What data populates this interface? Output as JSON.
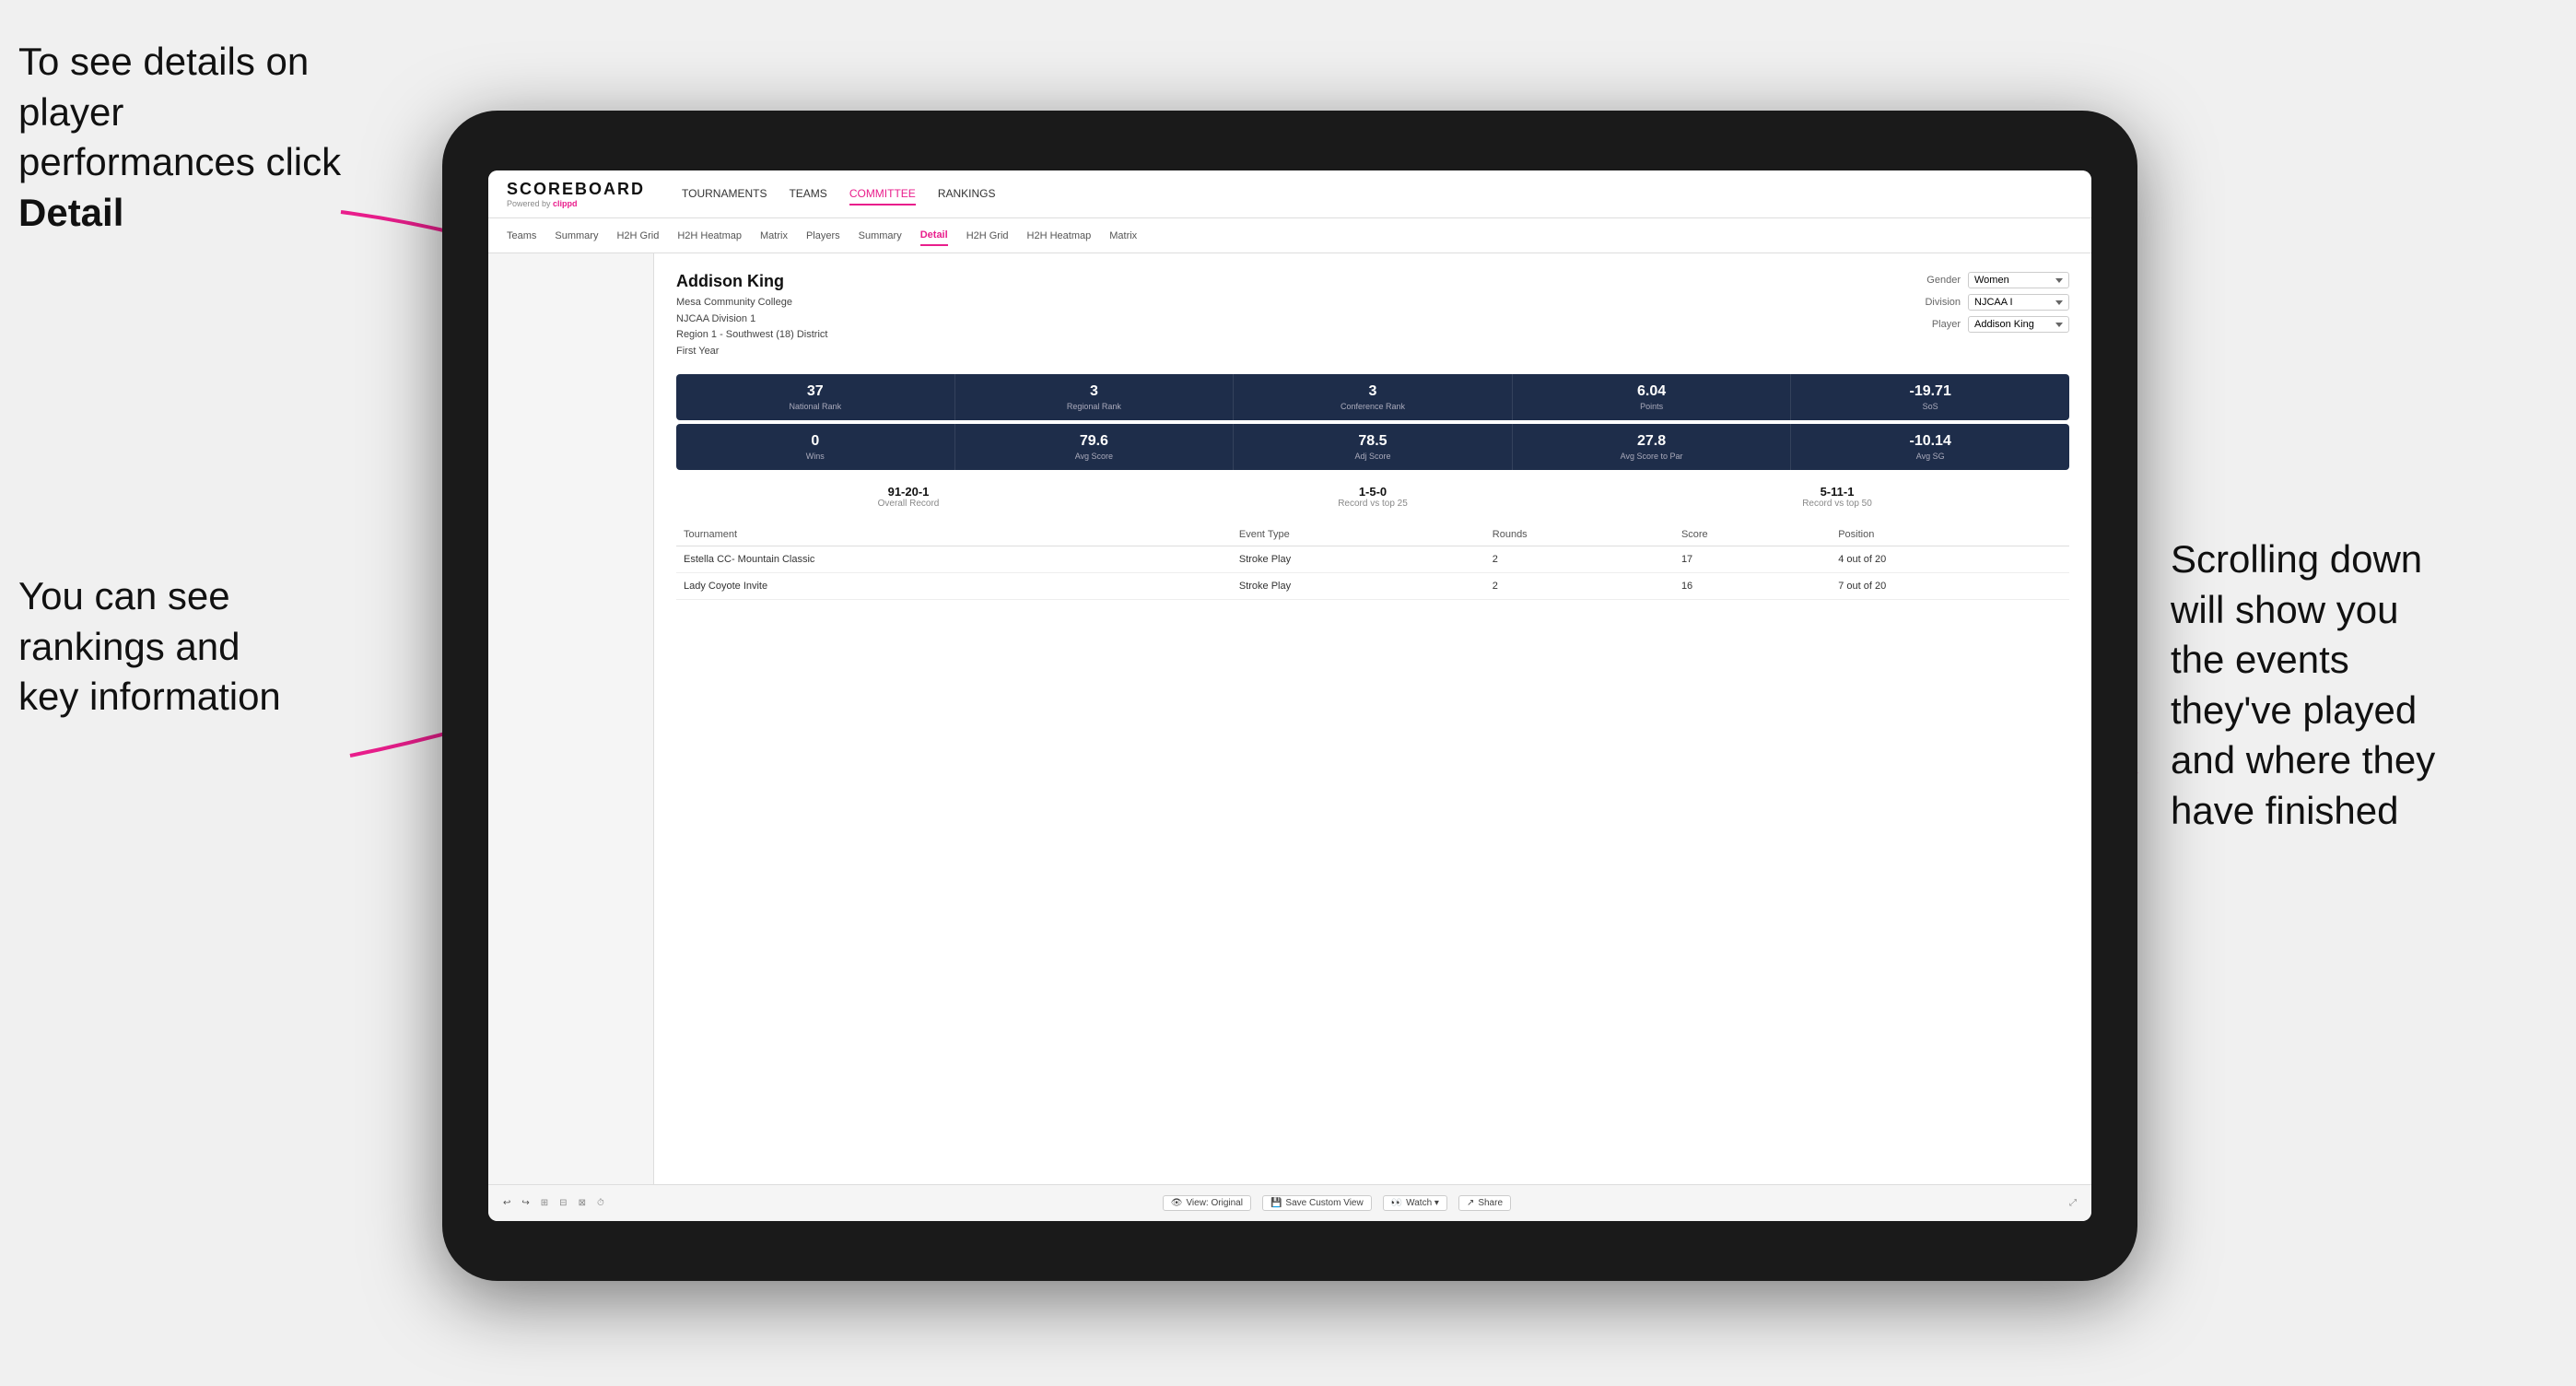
{
  "annotations": {
    "topleft": "To see details on player performances click ",
    "topleft_bold": "Detail",
    "bottomleft_line1": "You can see",
    "bottomleft_line2": "rankings and",
    "bottomleft_line3": "key information",
    "right_line1": "Scrolling down",
    "right_line2": "will show you",
    "right_line3": "the events",
    "right_line4": "they've played",
    "right_line5": "and where they",
    "right_line6": "have finished"
  },
  "nav": {
    "logo": "SCOREBOARD",
    "powered_by": "Powered by ",
    "clippd": "clippd",
    "items": [
      "TOURNAMENTS",
      "TEAMS",
      "COMMITTEE",
      "RANKINGS"
    ]
  },
  "sub_nav": {
    "items": [
      "Teams",
      "Summary",
      "H2H Grid",
      "H2H Heatmap",
      "Matrix",
      "Players",
      "Summary",
      "Detail",
      "H2H Grid",
      "H2H Heatmap",
      "Matrix"
    ],
    "active": "Detail"
  },
  "player": {
    "name": "Addison King",
    "school": "Mesa Community College",
    "division": "NJCAA Division 1",
    "region": "Region 1 - Southwest (18) District",
    "year": "First Year",
    "controls": {
      "gender_label": "Gender",
      "gender_value": "Women",
      "division_label": "Division",
      "division_value": "NJCAA I",
      "player_label": "Player",
      "player_value": "Addison King"
    }
  },
  "stats_row1": [
    {
      "value": "37",
      "label": "National Rank"
    },
    {
      "value": "3",
      "label": "Regional Rank"
    },
    {
      "value": "3",
      "label": "Conference Rank"
    },
    {
      "value": "6.04",
      "label": "Points"
    },
    {
      "value": "-19.71",
      "label": "SoS"
    }
  ],
  "stats_row2": [
    {
      "value": "0",
      "label": "Wins"
    },
    {
      "value": "79.6",
      "label": "Avg Score"
    },
    {
      "value": "78.5",
      "label": "Adj Score"
    },
    {
      "value": "27.8",
      "label": "Avg Score to Par"
    },
    {
      "value": "-10.14",
      "label": "Avg SG"
    }
  ],
  "records": [
    {
      "value": "91-20-1",
      "label": "Overall Record"
    },
    {
      "value": "1-5-0",
      "label": "Record vs top 25"
    },
    {
      "value": "5-11-1",
      "label": "Record vs top 50"
    }
  ],
  "table": {
    "headers": [
      "Tournament",
      "Event Type",
      "Rounds",
      "Score",
      "Position"
    ],
    "rows": [
      {
        "tournament": "Estella CC- Mountain Classic",
        "event_type": "Stroke Play",
        "rounds": "2",
        "score": "17",
        "position": "4 out of 20"
      },
      {
        "tournament": "Lady Coyote Invite",
        "event_type": "Stroke Play",
        "rounds": "2",
        "score": "16",
        "position": "7 out of 20"
      }
    ]
  },
  "toolbar": {
    "undo": "↩",
    "redo": "↪",
    "view_original": "View: Original",
    "save_custom": "Save Custom View",
    "watch": "Watch ▾",
    "share": "Share"
  }
}
